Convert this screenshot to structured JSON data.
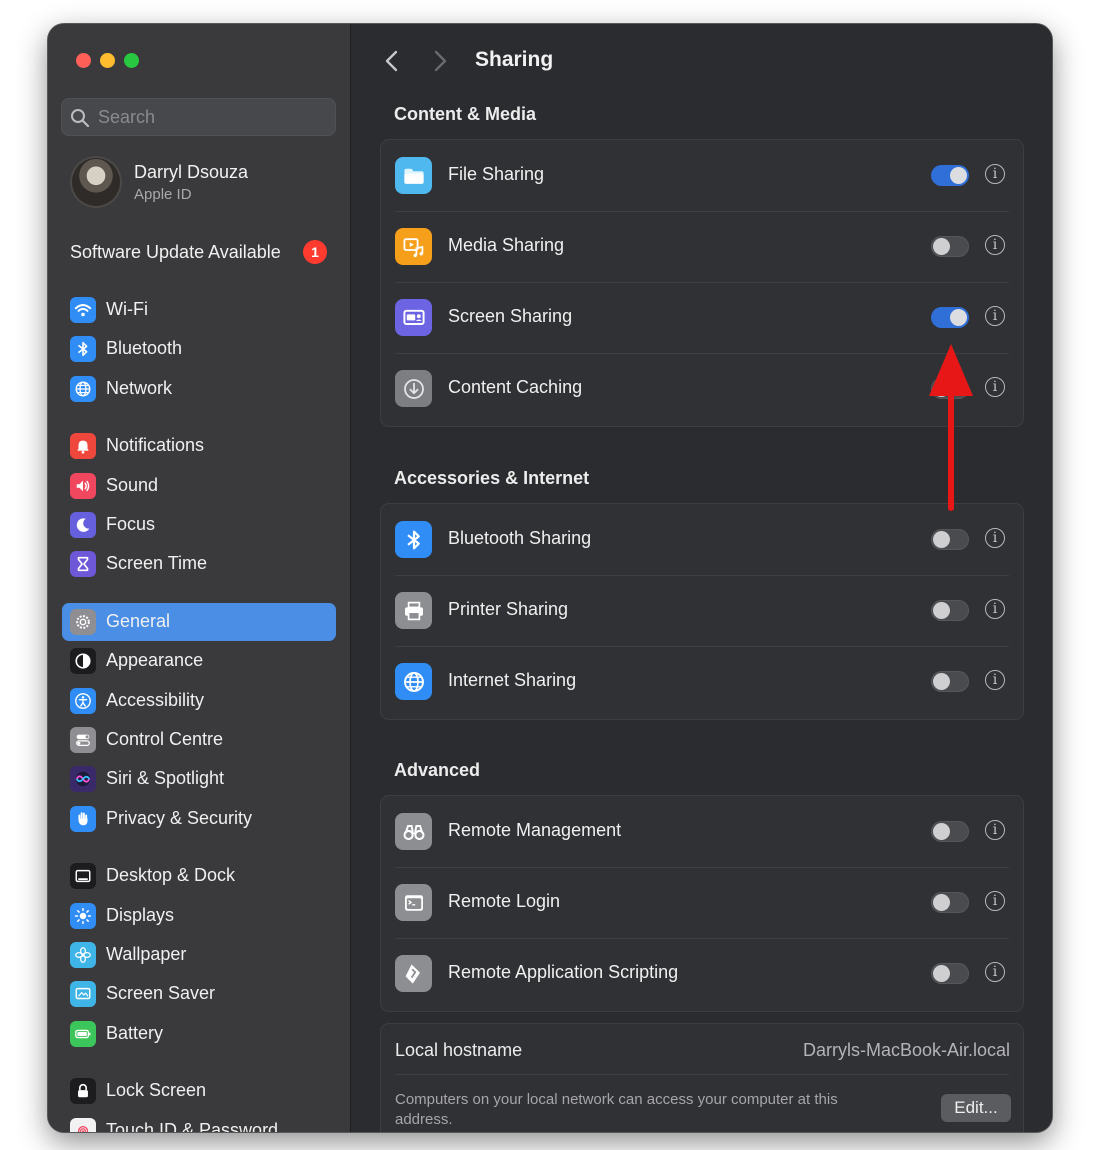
{
  "window": {
    "traffic_lights": {
      "close": "#ff5f57",
      "minimize": "#febc2e",
      "zoom": "#28c840"
    }
  },
  "sidebar": {
    "search_placeholder": "Search",
    "profile": {
      "name": "Darryl Dsouza",
      "subtitle": "Apple ID"
    },
    "update": {
      "label": "Software Update Available",
      "badge": "1"
    },
    "items": [
      {
        "label": "Wi-Fi",
        "icon": "wifi-icon",
        "color": "#2f8df5"
      },
      {
        "label": "Bluetooth",
        "icon": "bluetooth-icon",
        "color": "#2f8df5"
      },
      {
        "label": "Network",
        "icon": "globe-icon",
        "color": "#2f8df5"
      },
      {
        "label": "Notifications",
        "icon": "bell-icon",
        "color": "#f0473d"
      },
      {
        "label": "Sound",
        "icon": "speaker-icon",
        "color": "#f0475f"
      },
      {
        "label": "Focus",
        "icon": "moon-icon",
        "color": "#6660df"
      },
      {
        "label": "Screen Time",
        "icon": "hourglass-icon",
        "color": "#6f58d8"
      },
      {
        "label": "General",
        "icon": "gear-icon",
        "color": "#8e8e93",
        "selected": true
      },
      {
        "label": "Appearance",
        "icon": "appearance-icon",
        "color": "#1c1c1e"
      },
      {
        "label": "Accessibility",
        "icon": "accessibility-icon",
        "color": "#2f8df5"
      },
      {
        "label": "Control Centre",
        "icon": "control-centre-icon",
        "color": "#8e8e93"
      },
      {
        "label": "Siri & Spotlight",
        "icon": "siri-icon",
        "color": "#3a2a6a"
      },
      {
        "label": "Privacy & Security",
        "icon": "hand-icon",
        "color": "#2f8df5"
      },
      {
        "label": "Desktop & Dock",
        "icon": "desktop-icon",
        "color": "#1c1c1e"
      },
      {
        "label": "Displays",
        "icon": "sun-icon",
        "color": "#2f8df5"
      },
      {
        "label": "Wallpaper",
        "icon": "flower-icon",
        "color": "#3fb4e6"
      },
      {
        "label": "Screen Saver",
        "icon": "screen-saver-icon",
        "color": "#3fb4e6"
      },
      {
        "label": "Battery",
        "icon": "battery-icon",
        "color": "#3cc55a"
      },
      {
        "label": "Lock Screen",
        "icon": "lock-icon",
        "color": "#1c1c1e"
      },
      {
        "label": "Touch ID & Password",
        "icon": "fingerprint-icon",
        "color": "#f2f2f2"
      }
    ]
  },
  "header": {
    "title": "Sharing",
    "back_icon": "chevron-left-icon",
    "forward_icon": "chevron-right-icon"
  },
  "sections": [
    {
      "title": "Content & Media",
      "rows": [
        {
          "label": "File Sharing",
          "icon": "folder-icon",
          "color": "#4fb8ee",
          "on": true
        },
        {
          "label": "Media Sharing",
          "icon": "media-icon",
          "color": "#f59f1b",
          "on": false
        },
        {
          "label": "Screen Sharing",
          "icon": "screen-sharing-icon",
          "color": "#6d64e4",
          "on": true
        },
        {
          "label": "Content Caching",
          "icon": "download-icon",
          "color": "#7d7e82",
          "on": false
        }
      ]
    },
    {
      "title": "Accessories & Internet",
      "rows": [
        {
          "label": "Bluetooth Sharing",
          "icon": "bluetooth-icon",
          "color": "#2f8df5",
          "on": false
        },
        {
          "label": "Printer Sharing",
          "icon": "printer-icon",
          "color": "#8d8e92",
          "on": false
        },
        {
          "label": "Internet Sharing",
          "icon": "globe-icon",
          "color": "#2f8df5",
          "on": false
        }
      ]
    },
    {
      "title": "Advanced",
      "rows": [
        {
          "label": "Remote Management",
          "icon": "binoculars-icon",
          "color": "#8d8e92",
          "on": false
        },
        {
          "label": "Remote Login",
          "icon": "terminal-icon",
          "color": "#8d8e92",
          "on": false
        },
        {
          "label": "Remote Application Scripting",
          "icon": "script-icon",
          "color": "#8d8e92",
          "on": false
        }
      ]
    }
  ],
  "hostname": {
    "label": "Local hostname",
    "value": "Darryls-MacBook-Air.local",
    "description": "Computers on your local network can access your computer at this address.",
    "edit_label": "Edit..."
  },
  "annotation": {
    "icon": "red-arrow-icon",
    "color": "#e81717"
  },
  "info_icon": "info-icon",
  "accent_color": "#2f6fd7"
}
